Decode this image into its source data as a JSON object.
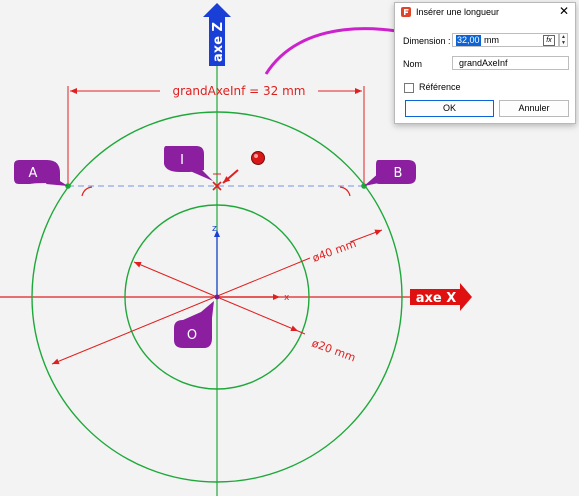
{
  "drawing": {
    "axis_z_label": "axe Z",
    "axis_x_label": "axe X",
    "dimension_text": "grandAxeInf = 32 mm",
    "dia_outer_text": "ø40 mm",
    "dia_inner_text": "ø20 mm",
    "small_z": "z",
    "small_x": "x",
    "callouts": {
      "a": "A",
      "b": "B",
      "i": "I",
      "o": "O"
    },
    "colors": {
      "circle": "#1fa83a",
      "dimension": "#e02020",
      "axis_z_arrow": "#1a3fd6",
      "axis_x_arrow": "#e01010",
      "callout": "#8b1fa0",
      "construction_line": "#8fa8e8",
      "pink_arrow": "#cc22cc"
    }
  },
  "dialog": {
    "title": "Insérer une longueur",
    "close_icon": "close-icon",
    "dimension_label": "Dimension :",
    "dimension_value": "32,00",
    "dimension_unit": "mm",
    "fx_label": "fx",
    "nom_label": "Nom",
    "nom_value": "grandAxeInf",
    "reference_label": "Référence",
    "reference_checked": false,
    "ok_label": "OK",
    "cancel_label": "Annuler"
  }
}
